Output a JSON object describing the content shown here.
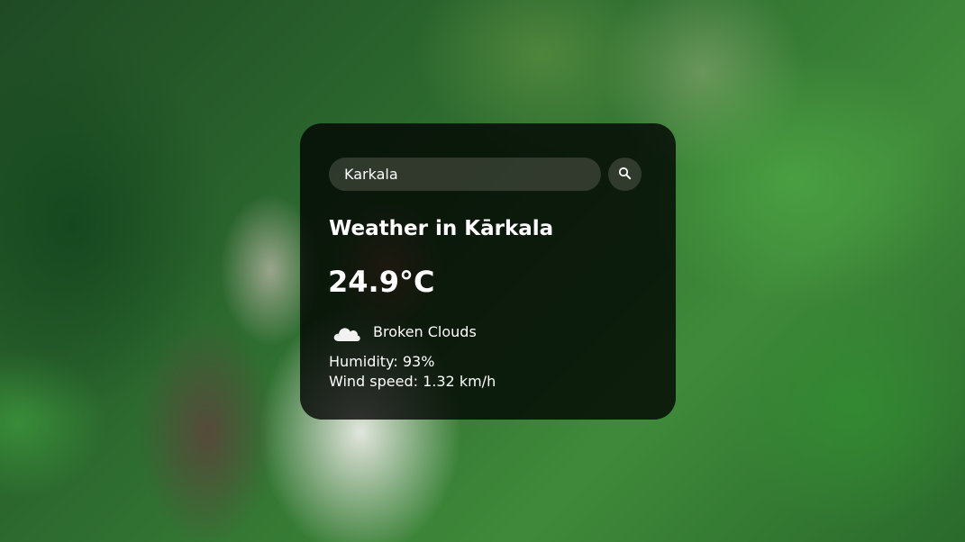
{
  "search": {
    "value": "Karkala",
    "button_icon": "search-icon"
  },
  "weather": {
    "title": "Weather in Kārkala",
    "temperature": "24.9°C",
    "condition_icon": "cloud-icon",
    "description": "Broken Clouds",
    "humidity": "Humidity: 93%",
    "wind": "Wind speed: 1.32 km/h"
  },
  "colors": {
    "card_background": "#000000",
    "text": "#ffffff",
    "background_green": "#2e6d30"
  }
}
